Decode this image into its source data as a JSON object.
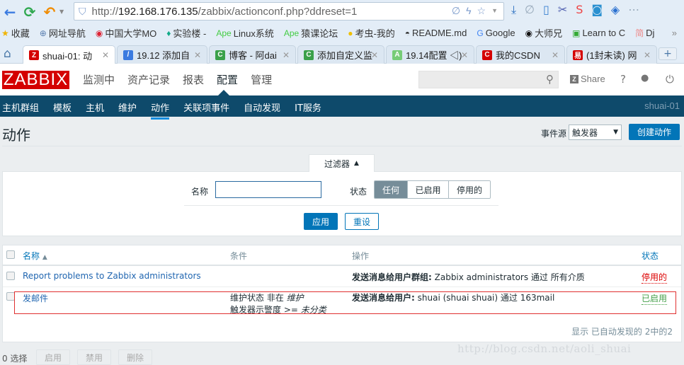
{
  "browser": {
    "url_prefix": "http://",
    "url_host": "192.168.176.135",
    "url_path": "/zabbix/actionconf.php?ddreset=1",
    "bookmarks": [
      {
        "icon": "star-icon",
        "glyph": "★",
        "label": "收藏",
        "color": "#f0b400"
      },
      {
        "icon": "globe-icon",
        "glyph": "⊕",
        "label": "网址导航",
        "color": "#5a7fb0"
      },
      {
        "icon": "mooc-icon",
        "glyph": "◉",
        "label": "中国大学MO",
        "color": "#d23"
      },
      {
        "icon": "leaf-icon",
        "glyph": "♦",
        "label": "实验楼 -",
        "color": "#1a8"
      },
      {
        "icon": "apes-icon",
        "glyph": "Ape",
        "label": "Linux系统",
        "color": "#4c4"
      },
      {
        "icon": "apes-icon",
        "glyph": "Ape",
        "label": "猿课论坛",
        "color": "#4c4"
      },
      {
        "icon": "bug-icon",
        "glyph": "●",
        "label": "考虫-我的",
        "color": "#f0c000"
      },
      {
        "icon": "hat-icon",
        "glyph": "◓",
        "label": "README.md",
        "color": "#333"
      },
      {
        "icon": "google-icon",
        "glyph": "G",
        "label": "Google",
        "color": "#4285f4"
      },
      {
        "icon": "github-icon",
        "glyph": "◉",
        "label": "大师兄",
        "color": "#111"
      },
      {
        "icon": "learn-icon",
        "glyph": "▣",
        "label": "Learn to C",
        "color": "#3a3"
      },
      {
        "icon": "jian-icon",
        "glyph": "简",
        "label": "Dj",
        "color": "#e88"
      }
    ],
    "bookmarks_more": "»",
    "tabs": [
      {
        "label": "shuai-01: 动",
        "fav": "Z",
        "fav_color": "#d40000",
        "active": true
      },
      {
        "label": "19.12 添加自",
        "fav": "/",
        "fav_color": "#3b7be0",
        "active": false
      },
      {
        "label": "博客 - 阿dai",
        "fav": "C",
        "fav_color": "#3aa04a",
        "active": false
      },
      {
        "label": "添加自定义监",
        "fav": "C",
        "fav_color": "#3aa04a",
        "active": false
      },
      {
        "label": "19.14配置 ◁)",
        "fav": "A",
        "fav_color": "#7c7",
        "active": false
      },
      {
        "label": "我的CSDN",
        "fav": "C",
        "fav_color": "#d40000",
        "active": false
      },
      {
        "label": "(1封未读) 网",
        "fav": "易",
        "fav_color": "#d40000",
        "active": false
      }
    ],
    "new_tab": "+"
  },
  "header": {
    "logo": "ZABBIX",
    "menu": [
      "监测中",
      "资产记录",
      "报表",
      "配置",
      "管理"
    ],
    "menu_selected": 3,
    "search_placeholder": "",
    "share_label": "Share",
    "help_glyph": "?",
    "user_glyph": "👤",
    "logout_glyph": "⏻"
  },
  "subnav": {
    "items": [
      "主机群组",
      "模板",
      "主机",
      "维护",
      "动作",
      "关联项事件",
      "自动发现",
      "IT服务"
    ],
    "selected": 4,
    "server_name": "shuai-01"
  },
  "page": {
    "title": "动作",
    "event_source_label": "事件源",
    "event_source_value": "触发器",
    "create_button": "创建动作"
  },
  "filter": {
    "tab_label": "过滤器",
    "name_label": "名称",
    "name_value": "",
    "status_label": "状态",
    "status_options": [
      "任何",
      "已启用",
      "停用的"
    ],
    "status_selected": 0,
    "apply_button": "应用",
    "reset_button": "重设"
  },
  "table": {
    "headers": {
      "name": "名称",
      "sort_glyph": "▲",
      "conditions": "条件",
      "operations": "操作",
      "status": "状态"
    },
    "rows": [
      {
        "name": "Report problems to Zabbix administrators",
        "conditions": [],
        "operation_bold": "发送消息给用户群组:",
        "operation_text": " Zabbix administrators 通过 所有介质",
        "status": "停用的",
        "status_type": "disabled"
      },
      {
        "name": "发邮件",
        "conditions": [
          {
            "text": "维护状态 非在 ",
            "value": "维护"
          },
          {
            "text": "触发器示警度 >= ",
            "value": "未分类"
          }
        ],
        "operation_bold": "发送消息给用户:",
        "operation_text": " shuai (shuai shuai) 通过 163mail",
        "status": "已启用",
        "status_type": "enabled",
        "highlighted": true
      }
    ],
    "footer": "显示 已自动发现的 2中的2"
  },
  "mass_actions": {
    "selected_count": "0 选择",
    "buttons": [
      "启用",
      "禁用",
      "删除"
    ]
  },
  "watermark": "http://blog.csdn.net/aoli_shuai",
  "colors": {
    "brand_red": "#d40000",
    "nav_blue": "#0e4a6b",
    "primary": "#0275b8",
    "enabled": "#429e47",
    "disabled": "#dc0000"
  }
}
